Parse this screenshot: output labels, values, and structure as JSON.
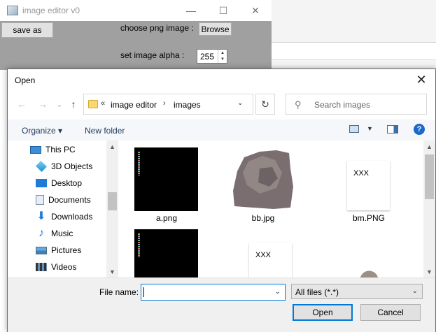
{
  "background_app": {
    "title": "image editor v0",
    "minimize_glyph": "—",
    "maximize_glyph": "☐",
    "close_glyph": "✕",
    "save_as_label": "save as",
    "choose_label": "choose png image :",
    "browse_label": "Browse",
    "alpha_label": "set image alpha :",
    "alpha_value": "255",
    "spin_up_glyph": "▲",
    "spin_down_glyph": "▼"
  },
  "dialog": {
    "title": "Open",
    "close_glyph": "✕",
    "nav": {
      "back_glyph": "←",
      "forward_glyph": "→",
      "recent_glyph": "⌄",
      "up_glyph": "↑"
    },
    "address": {
      "chevron": "«",
      "segments": [
        "image editor",
        "images"
      ],
      "separator": "›",
      "dropdown_glyph": "⌄",
      "refresh_glyph": "↻"
    },
    "search": {
      "icon_glyph": "⚲",
      "placeholder": "Search images"
    },
    "toolbar": {
      "organize_label": "Organize ▾",
      "new_folder_label": "New folder",
      "view_drop_glyph": "▼",
      "help_glyph": "?"
    },
    "nav_pane": {
      "items": [
        {
          "label": "This PC",
          "icon": "this-pc-icon"
        },
        {
          "label": "3D Objects",
          "icon": "3d-objects-icon"
        },
        {
          "label": "Desktop",
          "icon": "desktop-icon"
        },
        {
          "label": "Documents",
          "icon": "documents-icon"
        },
        {
          "label": "Downloads",
          "icon": "downloads-icon"
        },
        {
          "label": "Music",
          "icon": "music-icon"
        },
        {
          "label": "Pictures",
          "icon": "pictures-icon"
        },
        {
          "label": "Videos",
          "icon": "videos-icon"
        }
      ],
      "scroll_up_glyph": "▲",
      "scroll_down_glyph": "▼"
    },
    "files": {
      "items": [
        {
          "name": "a.png",
          "kind": "black-image"
        },
        {
          "name": "bb.jpg",
          "kind": "rock-image"
        },
        {
          "name": "bm.PNG",
          "kind": "text-image",
          "thumb_text": "XXX"
        },
        {
          "name": "",
          "kind": "black-image"
        },
        {
          "name": "",
          "kind": "text-image",
          "thumb_text": "XXX"
        },
        {
          "name": "",
          "kind": "rock-image"
        }
      ],
      "scroll_up_glyph": "▲",
      "scroll_down_glyph": "▼"
    },
    "bottom": {
      "file_name_label": "File name:",
      "file_name_value": "",
      "file_name_drop_glyph": "⌄",
      "filter_value": "All files (*.*)",
      "filter_drop_glyph": "⌄",
      "open_label": "Open",
      "cancel_label": "Cancel"
    }
  }
}
